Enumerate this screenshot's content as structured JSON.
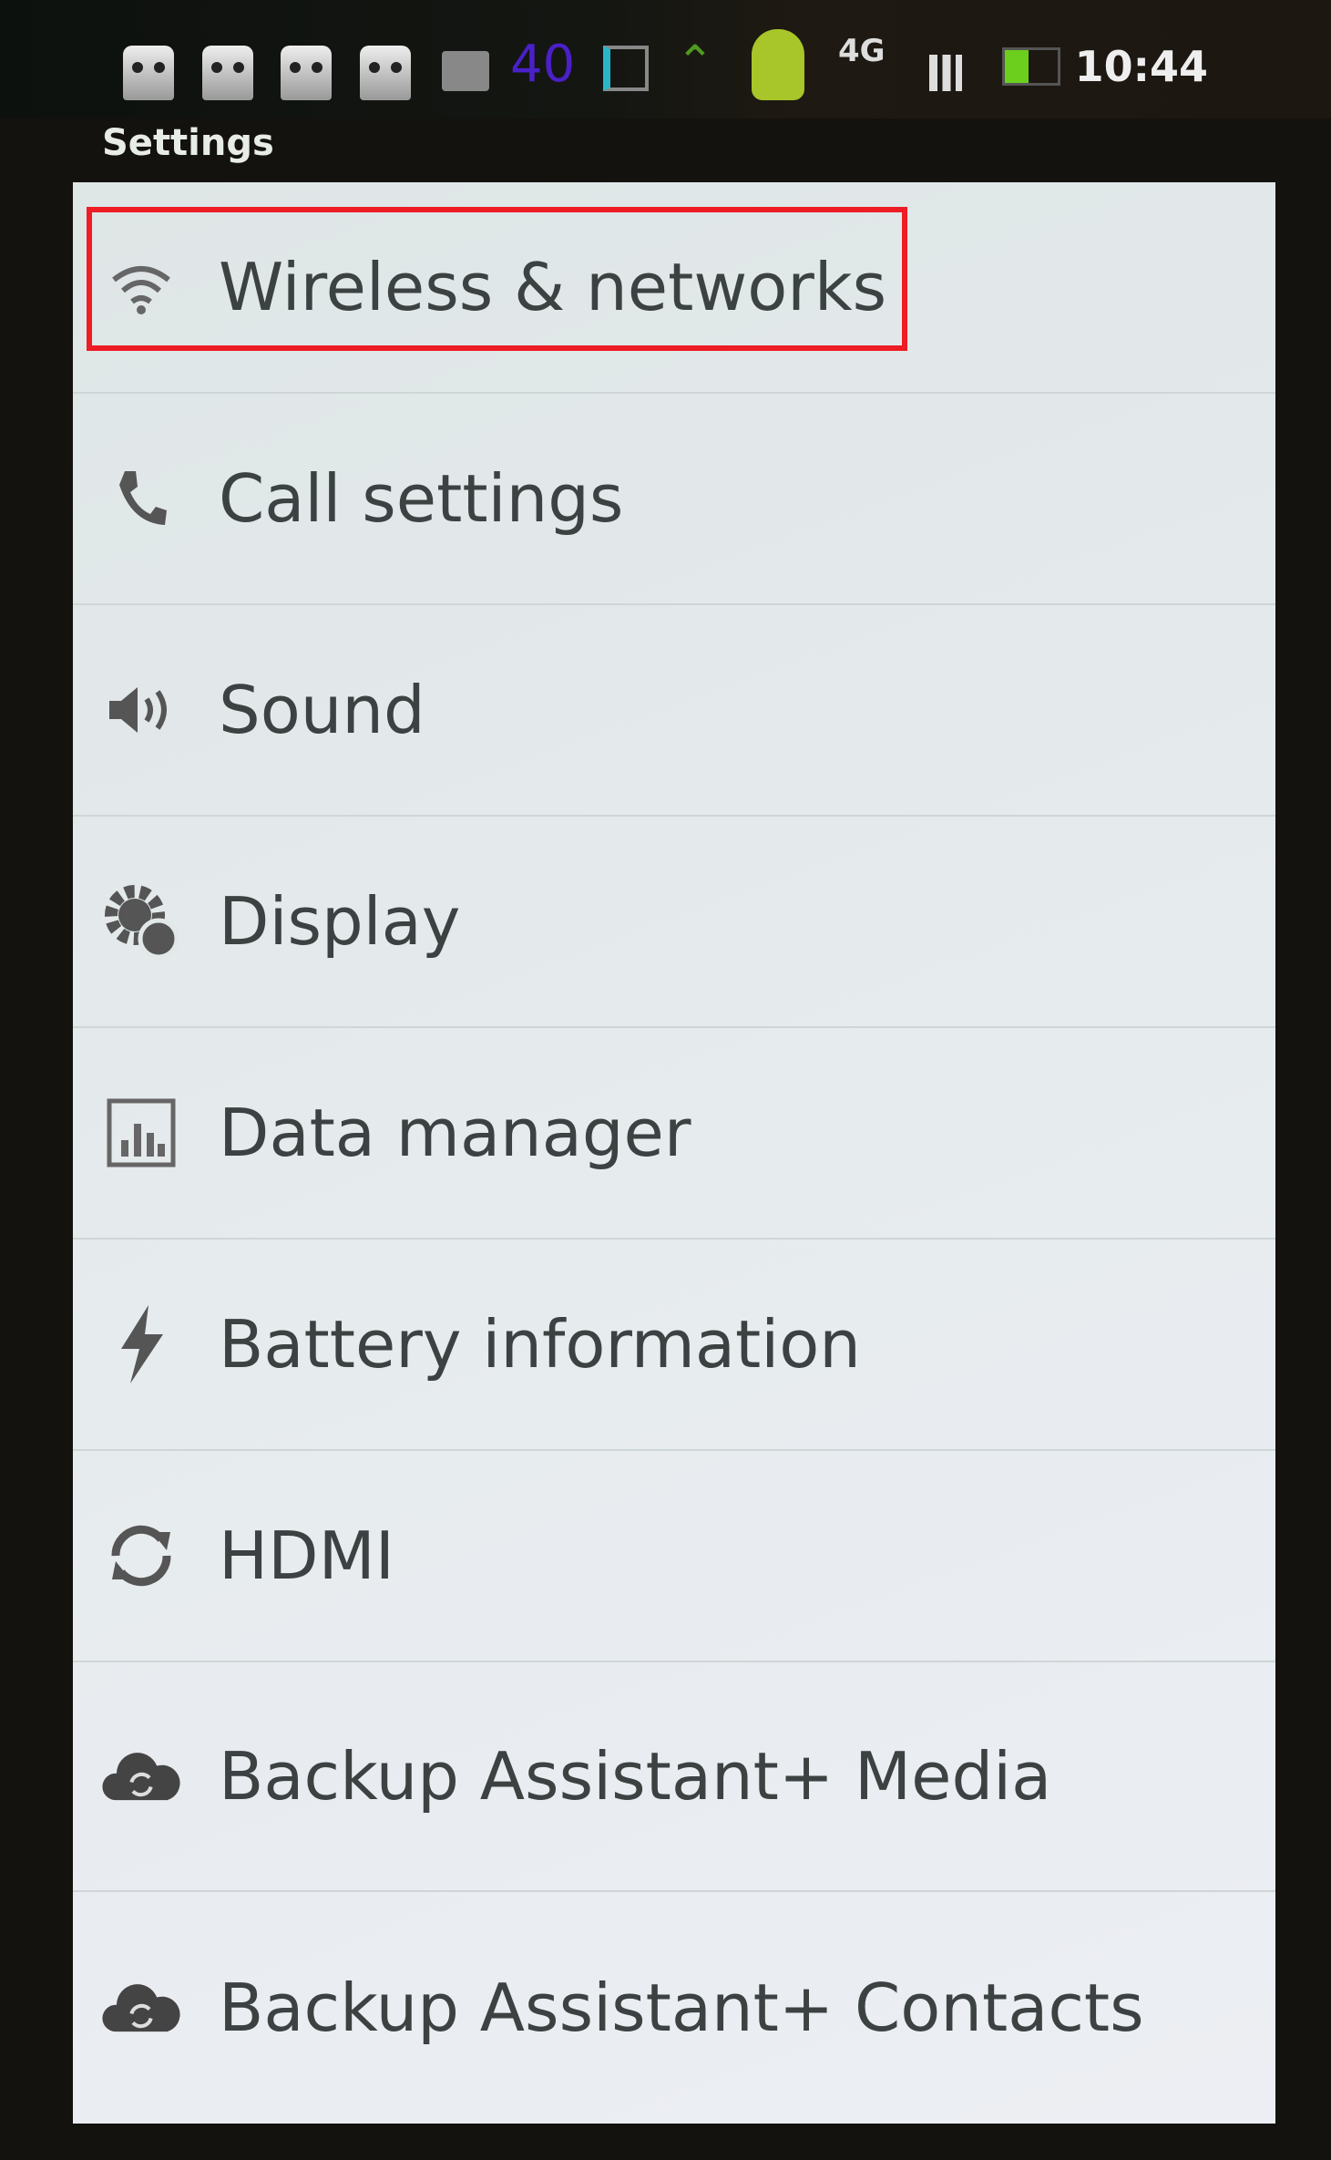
{
  "status_bar": {
    "time": "10:44",
    "badge_number": "40",
    "network": "4G",
    "icons": [
      "owl-notification-icon",
      "owl-notification-icon",
      "owl-notification-icon",
      "owl-notification-icon",
      "keyboard-icon",
      "calendar-badge-icon",
      "sd-card-icon",
      "sync-arrow-icon",
      "android-icon",
      "4g-data-icon",
      "signal-icon",
      "battery-icon"
    ],
    "accent_colors": {
      "badge": "#4a20c8",
      "battery": "#6ccf1e",
      "highlight": "#ee1c24"
    }
  },
  "header": {
    "title": "Settings"
  },
  "settings": {
    "items": [
      {
        "label": "Wireless & networks",
        "icon": "wifi-icon",
        "highlighted": true
      },
      {
        "label": "Call settings",
        "icon": "phone-icon"
      },
      {
        "label": "Sound",
        "icon": "speaker-icon"
      },
      {
        "label": "Display",
        "icon": "gear-display-icon"
      },
      {
        "label": "Data manager",
        "icon": "data-chart-icon"
      },
      {
        "label": "Battery information",
        "icon": "lightning-icon"
      },
      {
        "label": "HDMI",
        "icon": "sync-icon"
      },
      {
        "label": "Backup Assistant+ Media",
        "icon": "cloud-sync-icon"
      },
      {
        "label": "Backup Assistant+ Contacts",
        "icon": "cloud-sync-icon"
      }
    ]
  }
}
